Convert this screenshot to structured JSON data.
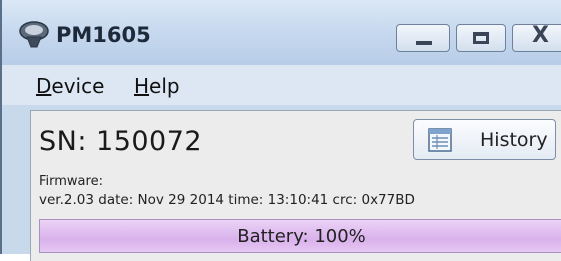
{
  "window": {
    "title": "PM1605",
    "app_icon": "device-icon",
    "controls": {
      "minimize_icon": "minimize-icon",
      "maximize_icon": "maximize-icon",
      "close_icon": "close-icon",
      "close_glyph": "X"
    }
  },
  "menu": {
    "device": {
      "mnemonic": "D",
      "rest": "evice"
    },
    "help": {
      "mnemonic": "H",
      "rest": "elp"
    }
  },
  "device": {
    "serial": "SN: 150072",
    "history_label": "History",
    "history_icon": "history-icon",
    "firmware_label": "Firmware:",
    "firmware_info": "ver.2.03 date: Nov 29 2014 time: 13:10:41  crc: 0x77BD"
  },
  "battery": {
    "label": "Battery: 100%",
    "level_percent": 100,
    "color": "#d9b1ec"
  }
}
